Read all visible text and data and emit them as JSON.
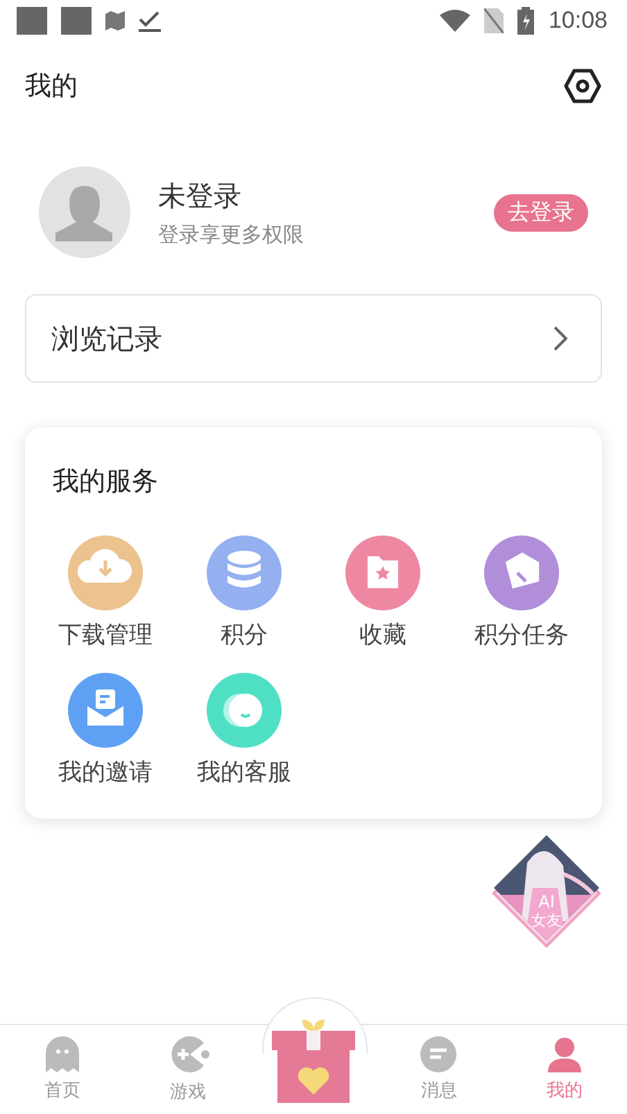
{
  "status_bar": {
    "time": "10:08"
  },
  "header": {
    "title": "我的"
  },
  "profile": {
    "name": "未登录",
    "subtitle": "登录享更多权限",
    "login_button": "去登录"
  },
  "history": {
    "label": "浏览记录"
  },
  "services": {
    "title": "我的服务",
    "items": [
      {
        "label": "下载管理",
        "color": "#ecc28e"
      },
      {
        "label": "积分",
        "color": "#94b0f0"
      },
      {
        "label": "收藏",
        "color": "#ee88a2"
      },
      {
        "label": "积分任务",
        "color": "#b18ed9"
      },
      {
        "label": "我的邀请",
        "color": "#5ea1f4"
      },
      {
        "label": "我的客服",
        "color": "#4fe0c4"
      }
    ]
  },
  "ai_badge": {
    "line1": "AI",
    "line2": "女友"
  },
  "bottom_nav": {
    "tabs": [
      {
        "label": "首页",
        "selected": false
      },
      {
        "label": "游戏",
        "selected": false
      },
      {
        "label": "消息",
        "selected": false
      },
      {
        "label": "我的",
        "selected": true
      }
    ]
  }
}
